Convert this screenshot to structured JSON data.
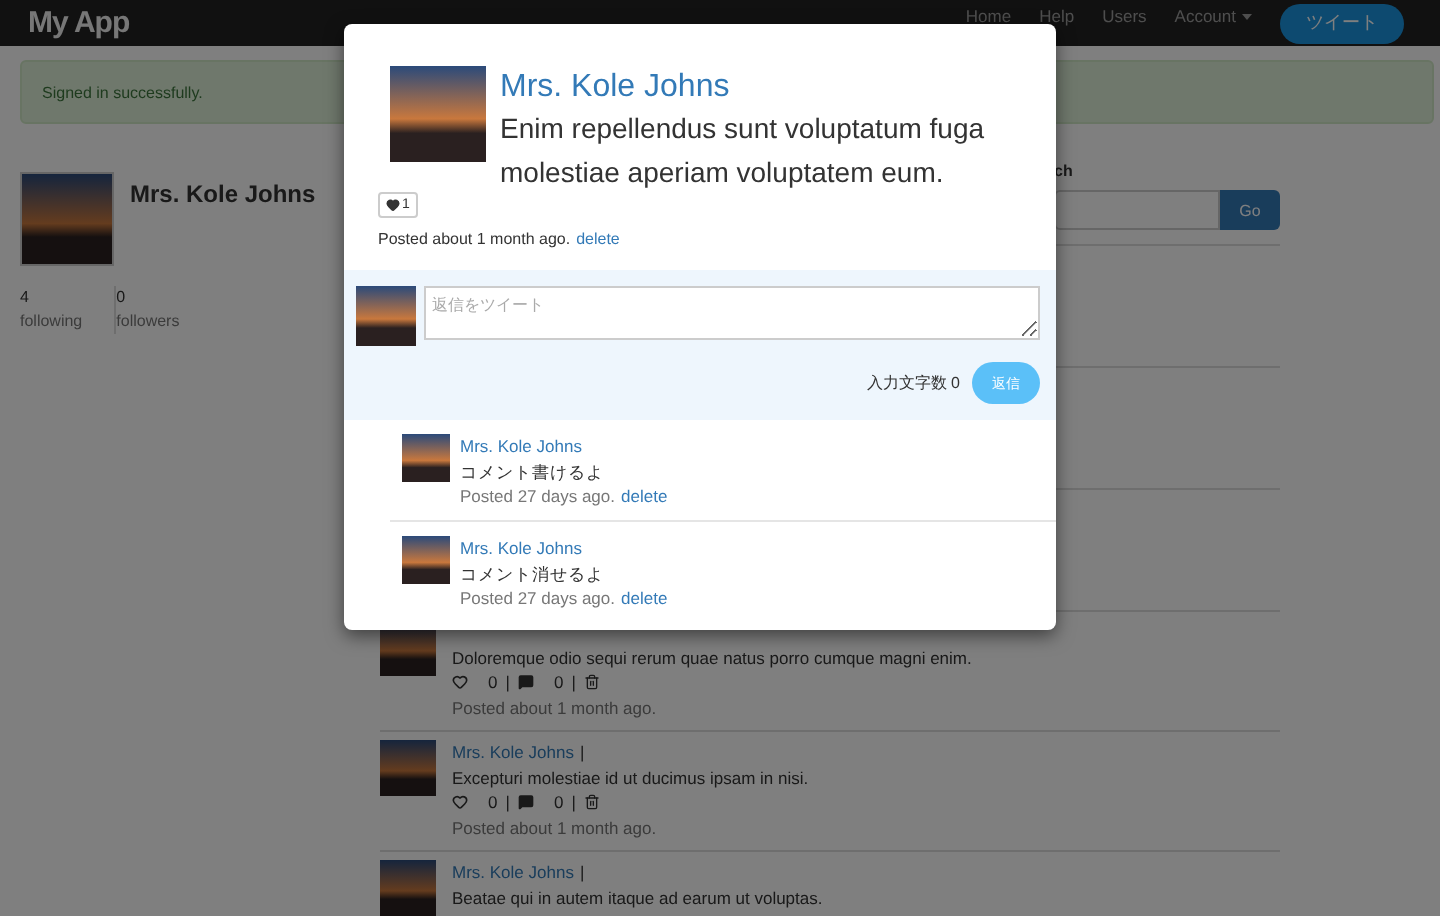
{
  "navbar": {
    "brand": "My App",
    "links": [
      {
        "label": "Home",
        "kind": "link"
      },
      {
        "label": "Help",
        "kind": "link"
      },
      {
        "label": "Users",
        "kind": "link"
      },
      {
        "label": "Account",
        "kind": "dropdown"
      }
    ],
    "tweet_button": "ツイート"
  },
  "flash": "Signed in successfully.",
  "profile": {
    "name": "Mrs. Kole Johns",
    "stats": [
      {
        "count": "4",
        "label": "following"
      },
      {
        "count": "0",
        "label": "followers"
      }
    ]
  },
  "search": {
    "label": "ch",
    "button": "Go"
  },
  "feed": [
    {
      "text": "Doloremque odio sequi rerum quae natus porro cumque magni enim.",
      "liked": false,
      "likes": "0",
      "comments": "0",
      "separator": "|",
      "posted": "Posted about 1 month ago."
    },
    {
      "name": "Mrs. Kole Johns",
      "name_separator": "|",
      "text": "Excepturi molestiae id ut ducimus ipsam in nisi.",
      "liked": false,
      "likes": "0",
      "comments": "0",
      "separator": "|",
      "posted": "Posted about 1 month ago."
    },
    {
      "name": "Mrs. Kole Johns",
      "name_separator": "|",
      "text": "Beatae qui in autem itaque ad earum ut voluptas."
    }
  ],
  "modal": {
    "author": "Mrs. Kole Johns",
    "text": "Enim repellendus sunt voluptatum fuga molestiae aperiam voluptatem eum.",
    "like": {
      "liked": true,
      "count": "1"
    },
    "posted": "Posted about 1 month ago.",
    "delete": "delete",
    "reply": {
      "placeholder": "返信をツイート",
      "counter": "入力文字数 0",
      "button": "返信"
    },
    "comments": [
      {
        "author": "Mrs. Kole Johns",
        "text": "コメント書けるよ",
        "posted": "Posted 27 days ago.",
        "delete": "delete"
      },
      {
        "author": "Mrs. Kole Johns",
        "text": "コメント消せるよ",
        "posted": "Posted 27 days ago.",
        "delete": "delete"
      }
    ]
  }
}
